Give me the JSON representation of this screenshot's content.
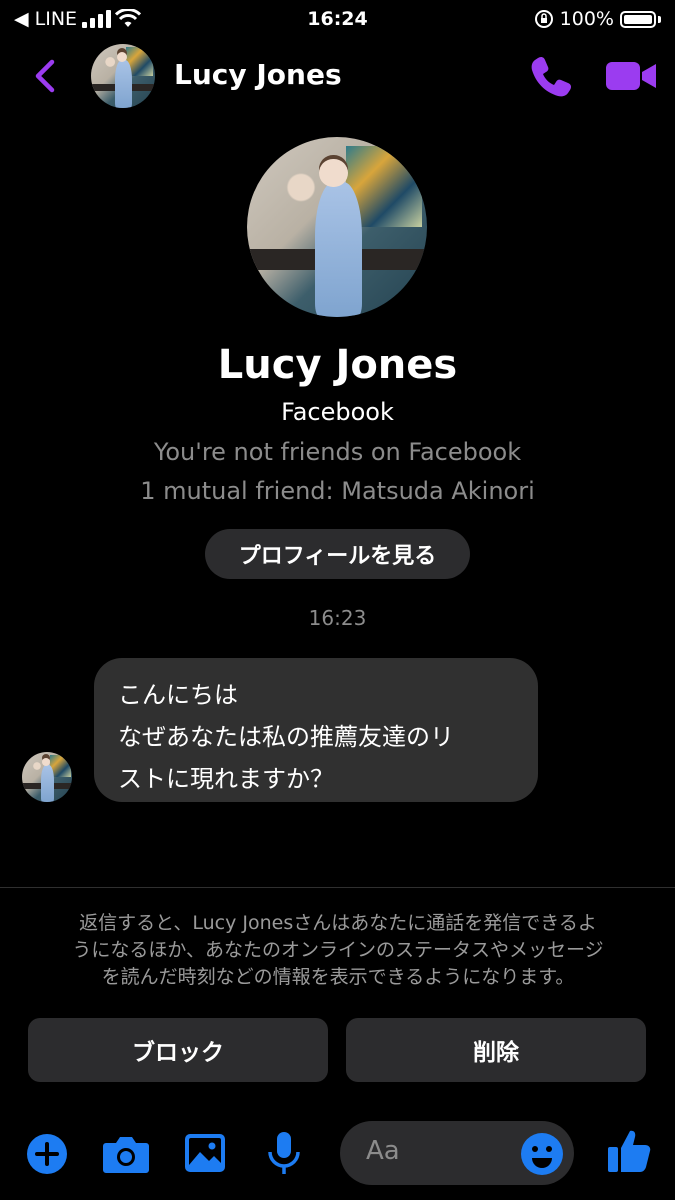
{
  "status_bar": {
    "carrier": "◀ LINE",
    "time": "16:24",
    "battery": "100%"
  },
  "header": {
    "name": "Lucy Jones"
  },
  "profile": {
    "name": "Lucy Jones",
    "source": "Facebook",
    "friend_status": "You're not friends on Facebook",
    "mutual": "1 mutual friend: Matsuda Akinori",
    "view_profile_label": "プロフィールを見る"
  },
  "conversation": {
    "timestamp": "16:23",
    "message_line1": "こんにちは",
    "message_line2": "なぜあなたは私の推薦友達のリ",
    "message_line3": "ストに現れますか？"
  },
  "request": {
    "notice_line1": "返信すると、Lucy Jonesさんはあなたに通話を発信できるよ",
    "notice_line2": "うになるほか、あなたのオンラインのステータスやメッセージ",
    "notice_line3": "を読んだ時刻などの情報を表示できるようになります。",
    "block_label": "ブロック",
    "delete_label": "削除"
  },
  "composer": {
    "placeholder": "Aa"
  },
  "colors": {
    "accent_purple": "#9b3cf0",
    "accent_blue": "#1d7cf2",
    "background": "#000000",
    "bubble": "#303030"
  },
  "icons": [
    "back-chevron-icon",
    "phone-icon",
    "video-icon",
    "plus-icon",
    "camera-icon",
    "image-icon",
    "microphone-icon",
    "emoji-icon",
    "thumbs-up-icon",
    "signal-icon",
    "wifi-icon",
    "lock-rotation-icon",
    "battery-icon"
  ]
}
